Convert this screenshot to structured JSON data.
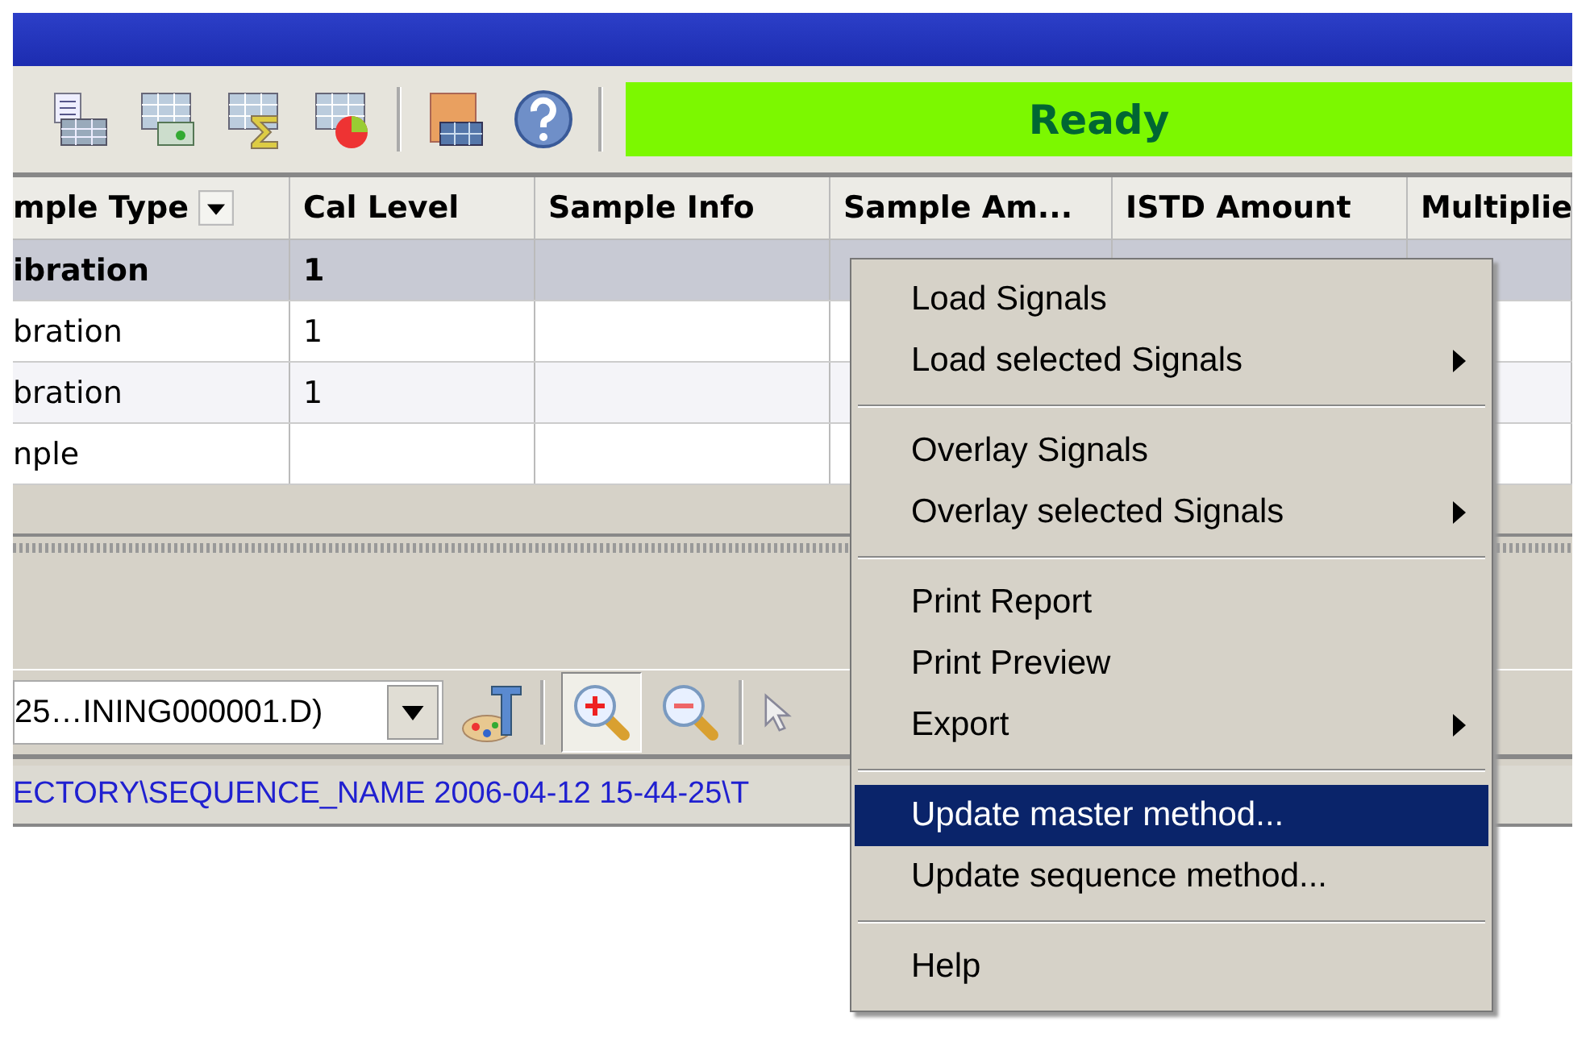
{
  "toolbar": {
    "status": "Ready"
  },
  "table": {
    "columns": [
      {
        "label": "mple Type",
        "filter": true
      },
      {
        "label": "Cal Level",
        "filter": false
      },
      {
        "label": "Sample Info",
        "filter": false
      },
      {
        "label": "Sample Am...",
        "filter": false
      },
      {
        "label": "ISTD Amount",
        "filter": false
      },
      {
        "label": "Multiplie",
        "filter": false
      }
    ],
    "rows": [
      {
        "selected": true,
        "cells": [
          "ibration",
          "1"
        ]
      },
      {
        "selected": false,
        "cells": [
          "bration",
          "1"
        ]
      },
      {
        "selected": false,
        "cells": [
          "bration",
          "1"
        ]
      },
      {
        "selected": false,
        "cells": [
          "nple",
          ""
        ]
      }
    ]
  },
  "signal_toolbar": {
    "file_combo": "25…INING000001.D)",
    "zoom_in_pressed": true
  },
  "path": "ECTORY\\SEQUENCE_NAME 2006-04-12 15-44-25\\T",
  "context_menu": {
    "groups": [
      [
        {
          "label": "Load Signals",
          "submenu": false,
          "selected": false
        },
        {
          "label": "Load selected Signals",
          "submenu": true,
          "selected": false
        }
      ],
      [
        {
          "label": "Overlay Signals",
          "submenu": false,
          "selected": false
        },
        {
          "label": "Overlay selected Signals",
          "submenu": true,
          "selected": false
        }
      ],
      [
        {
          "label": "Print Report",
          "submenu": false,
          "selected": false
        },
        {
          "label": "Print Preview",
          "submenu": false,
          "selected": false
        },
        {
          "label": "Export",
          "submenu": true,
          "selected": false
        }
      ],
      [
        {
          "label": "Update master method...",
          "submenu": false,
          "selected": true
        },
        {
          "label": "Update sequence method...",
          "submenu": false,
          "selected": false
        }
      ],
      [
        {
          "label": "Help",
          "submenu": false,
          "selected": false
        }
      ]
    ]
  }
}
